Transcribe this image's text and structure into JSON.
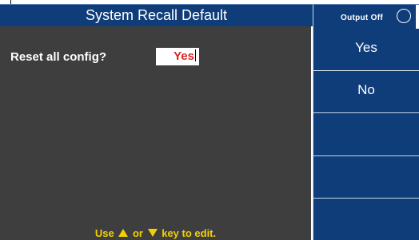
{
  "screen": {
    "title": "System Recall Default",
    "output_status": "Output Off"
  },
  "dialog": {
    "prompt": "Reset all config?",
    "value": "Yes"
  },
  "hint": {
    "prefix": "Use",
    "middle": "or",
    "suffix": "key to edit.",
    "up_icon": "up-arrow-icon",
    "down_icon": "down-arrow-icon"
  },
  "softkeys": [
    {
      "label": "Yes"
    },
    {
      "label": "No"
    },
    {
      "label": ""
    },
    {
      "label": ""
    },
    {
      "label": ""
    }
  ],
  "colors": {
    "panel_blue": "#0f3d7a",
    "content_gray": "#3e3e3e",
    "hint_yellow": "#f5d000",
    "value_red": "#e02020"
  }
}
